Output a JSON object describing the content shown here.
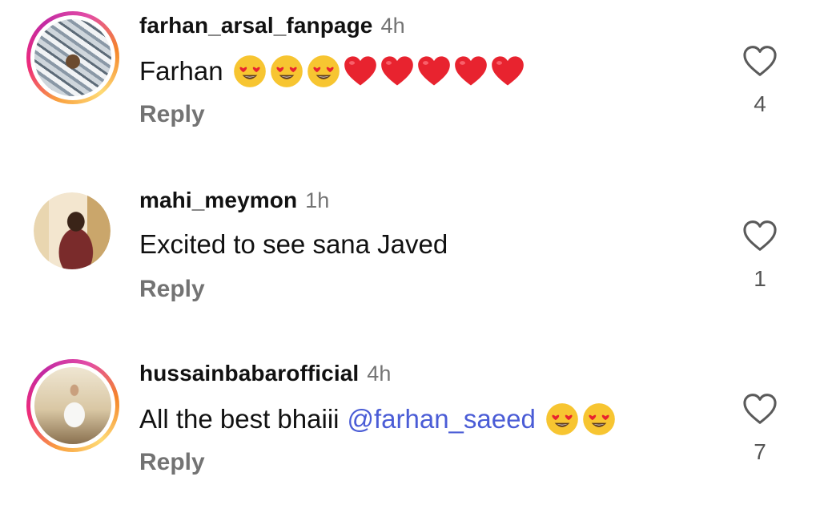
{
  "comments": [
    {
      "username": "farhan_arsal_fanpage",
      "time": "4h",
      "text": "Farhan",
      "mention": "",
      "emojis": [
        "heart-eyes-face",
        "heart-eyes-face",
        "heart-eyes-face",
        "red-heart",
        "red-heart",
        "red-heart",
        "red-heart",
        "red-heart"
      ],
      "reply_label": "Reply",
      "likes": "4",
      "avatar_story_ring": true
    },
    {
      "username": "mahi_meymon",
      "time": "1h",
      "text": "Excited to see sana Javed",
      "mention": "",
      "emojis": [],
      "reply_label": "Reply",
      "likes": "1",
      "avatar_story_ring": false
    },
    {
      "username": "hussainbabarofficial",
      "time": "4h",
      "text": "All the best bhaiii",
      "mention": "@farhan_saeed",
      "emojis": [
        "heart-eyes-face",
        "heart-eyes-face"
      ],
      "reply_label": "Reply",
      "likes": "7",
      "avatar_story_ring": true
    }
  ],
  "colors": {
    "text": "#111111",
    "secondary": "#737373",
    "mention": "#4a5cd6",
    "heart_emoji": "#e8232f",
    "face_emoji": "#f7c531"
  }
}
